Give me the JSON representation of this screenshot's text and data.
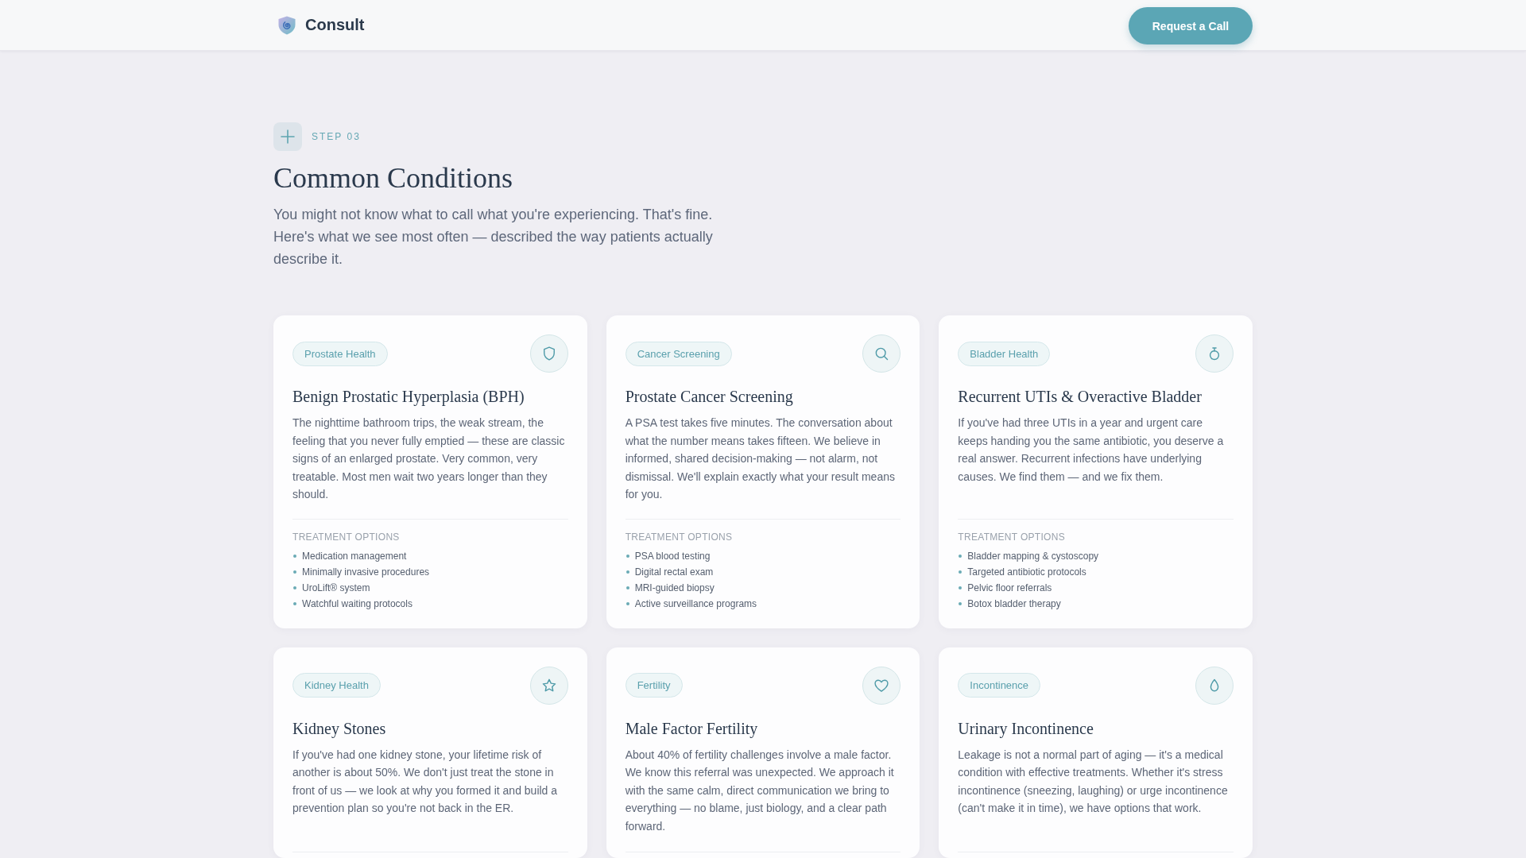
{
  "header": {
    "brand": "Consult",
    "cta_button": "Request a Call"
  },
  "section": {
    "step_label": "STEP 03",
    "title": "Common Conditions",
    "intro": "You might not know what to call what you're experiencing. That's fine. Here's what we see most often — described the way patients actually describe it."
  },
  "conditions": [
    {
      "tag": "Prostate Health",
      "title": "Benign Prostatic Hyperplasia (BPH)",
      "description": "The nighttime bathroom trips, the weak stream, the feeling that you never fully emptied — these are classic signs of an enlarged prostate. Very common, very treatable. Most men wait two years longer than they should.",
      "treatments_label": "TREATMENT OPTIONS",
      "treatments": [
        "Medication management",
        "Minimally invasive procedures",
        "UroLift® system",
        "Watchful waiting protocols"
      ]
    },
    {
      "tag": "Cancer Screening",
      "title": "Prostate Cancer Screening",
      "description": "A PSA test takes five minutes. The conversation about what the number means takes fifteen. We believe in informed, shared decision-making — not alarm, not dismissal. We'll explain exactly what your result means for you.",
      "treatments_label": "TREATMENT OPTIONS",
      "treatments": [
        "PSA blood testing",
        "Digital rectal exam",
        "MRI-guided biopsy",
        "Active surveillance programs"
      ]
    },
    {
      "tag": "Bladder Health",
      "title": "Recurrent UTIs & Overactive Bladder",
      "description": "If you've had three UTIs in a year and urgent care keeps handing you the same antibiotic, you deserve a real answer. Recurrent infections have underlying causes. We find them — and we fix them.",
      "treatments_label": "TREATMENT OPTIONS",
      "treatments": [
        "Bladder mapping & cystoscopy",
        "Targeted antibiotic protocols",
        "Pelvic floor referrals",
        "Botox bladder therapy"
      ]
    },
    {
      "tag": "Kidney Health",
      "title": "Kidney Stones",
      "description": "If you've had one kidney stone, your lifetime risk of another is about 50%. We don't just treat the stone in front of us — we look at why you formed it and build a prevention plan so you're not back in the ER."
    },
    {
      "tag": "Fertility",
      "title": "Male Factor Fertility",
      "description": "About 40% of fertility challenges involve a male factor. We know this referral was unexpected. We approach it with the same calm, direct communication we bring to everything — no blame, just biology, and a clear path forward."
    },
    {
      "tag": "Incontinence",
      "title": "Urinary Incontinence",
      "description": "Leakage is not a normal part of aging — it's a medical condition with effective treatments. Whether it's stress incontinence (sneezing, laughing) or urge incontinence (can't make it in time), we have options that work."
    }
  ]
}
